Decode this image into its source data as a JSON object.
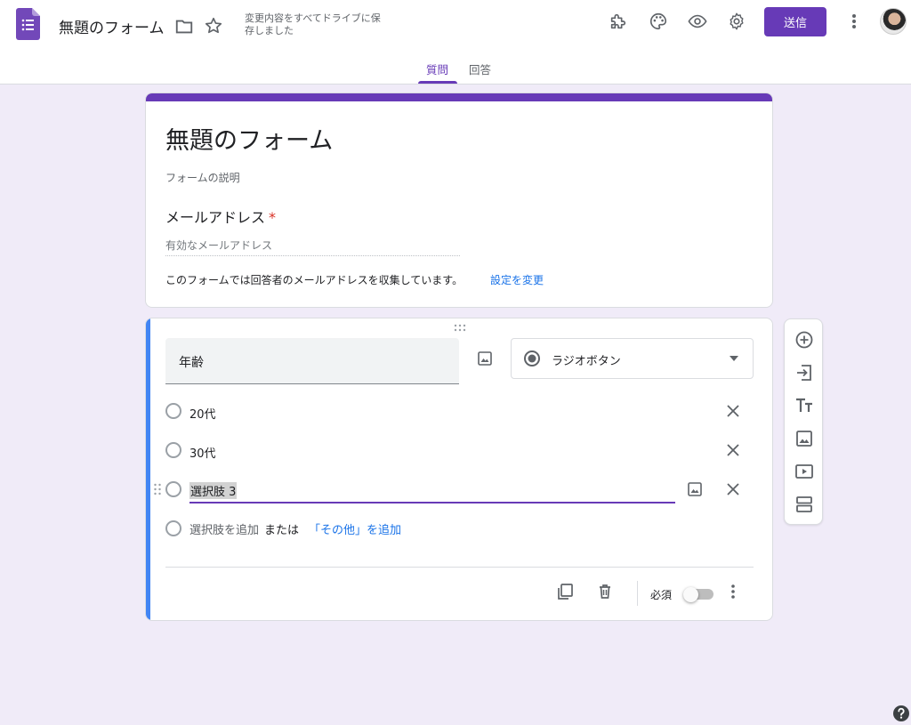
{
  "header": {
    "doc_title": "無題のフォーム",
    "save_status": "変更内容をすべてドライブに保存しました",
    "send_label": "送信",
    "icons": [
      "app-logo-icon",
      "folder-icon",
      "star-icon",
      "addon-icon",
      "palette-icon",
      "preview-icon",
      "settings-icon",
      "more-vert-icon",
      "avatar"
    ]
  },
  "tabs": [
    {
      "label": "質問",
      "active": true
    },
    {
      "label": "回答",
      "active": false
    }
  ],
  "form": {
    "title": "無題のフォーム",
    "description_placeholder": "フォームの説明",
    "email_label": "メールアドレス",
    "email_required_mark": "*",
    "email_placeholder": "有効なメールアドレス",
    "collect_note": "このフォームでは回答者のメールアドレスを収集しています。",
    "collect_link": "設定を変更"
  },
  "question": {
    "title": "年齢",
    "type": "ラジオボタン",
    "options": [
      {
        "label": "20代"
      },
      {
        "label": "30代"
      },
      {
        "label": "選択肢 3",
        "editing": true
      }
    ],
    "add_option": "選択肢を追加",
    "or_text": "または",
    "add_other": "「その他」を追加",
    "required_label": "必須",
    "required_on": false
  },
  "side_toolbar": [
    "add-question-icon",
    "import-questions-icon",
    "add-title-icon",
    "add-image-icon",
    "add-video-icon",
    "add-section-icon"
  ],
  "colors": {
    "accent": "#673ab7",
    "background": "#f0ebf8",
    "link": "#1a73e8",
    "active_question_bar": "#4285f4"
  }
}
